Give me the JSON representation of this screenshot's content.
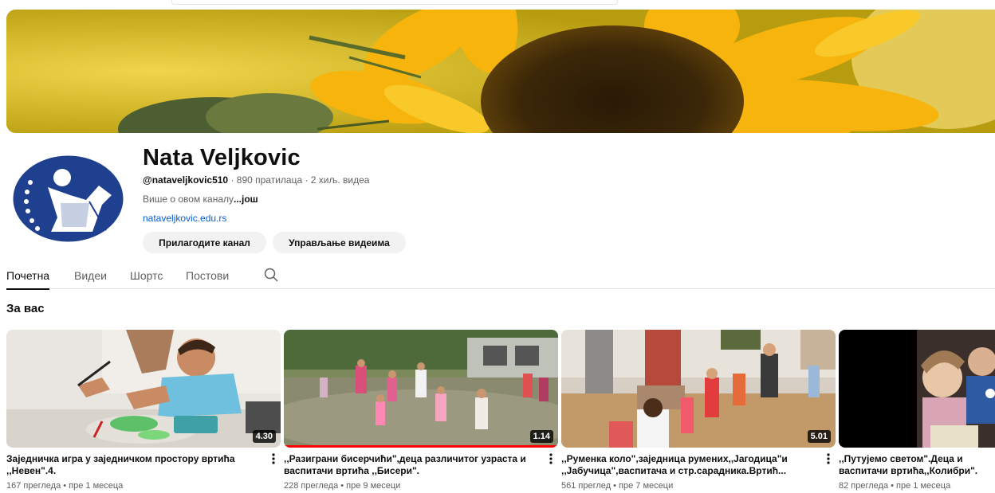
{
  "channel": {
    "name": "Nata Veljkovic",
    "handle": "@nataveljkovic510",
    "stats": " · 890 пратилаца · 2 хиљ. видеа",
    "about": "Више о овом каналу",
    "about_more": "...још",
    "link": "nataveljkovic.edu.rs",
    "customize_label": "Прилагодите канал",
    "manage_label": "Управљање видеима"
  },
  "tabs": [
    {
      "label": "Почетна",
      "active": true
    },
    {
      "label": "Видеи",
      "active": false
    },
    {
      "label": "Шортс",
      "active": false
    },
    {
      "label": "Постови",
      "active": false
    }
  ],
  "section": {
    "title": "За вас"
  },
  "videos": [
    {
      "title": "Заједничка игра у заједничком простору вртића ,,Невен\".4.",
      "duration": "4.30",
      "meta": "167 прегледа • пре 1 месеца",
      "progress": 0
    },
    {
      "title": ",,Разиграни бисерчићи\",деца различитог узраста и васпитачи вртића ,,Бисери\".",
      "duration": "1.14",
      "meta": "228 прегледа • пре 9 месеци",
      "progress": 1.0
    },
    {
      "title": ",,Руменка коло\",заједница румених,,Јагодица\"и ,,Јабучица\",васпитача и стр.сарадника.Вртић...",
      "duration": "5.01",
      "meta": "561 преглед • пре 7 месеци",
      "progress": 0
    },
    {
      "title": ",,Путујемо светом\".Деца и васпитачи вртића,,Колибри\".",
      "duration": "",
      "meta": "82 прегледа • пре 1 месеца",
      "progress": 0
    }
  ],
  "icons": {
    "search": "search-icon",
    "more": "more-vert-icon"
  },
  "colors": {
    "accent": "#ff0000",
    "link": "#065fd4",
    "avatar_blue": "#1f3f8f"
  }
}
